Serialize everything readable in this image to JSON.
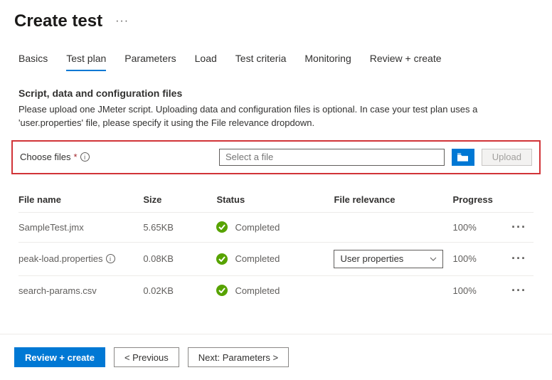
{
  "header": {
    "title": "Create test"
  },
  "tabs": [
    {
      "label": "Basics"
    },
    {
      "label": "Test plan"
    },
    {
      "label": "Parameters"
    },
    {
      "label": "Load"
    },
    {
      "label": "Test criteria"
    },
    {
      "label": "Monitoring"
    },
    {
      "label": "Review + create"
    }
  ],
  "section": {
    "title": "Script, data and configuration files",
    "desc": "Please upload one JMeter script. Uploading data and configuration files is optional. In case your test plan uses a 'user.properties' file, please specify it using the File relevance dropdown."
  },
  "choose": {
    "label": "Choose files",
    "required": "*",
    "placeholder": "Select a file",
    "upload": "Upload"
  },
  "table": {
    "headers": {
      "name": "File name",
      "size": "Size",
      "status": "Status",
      "relevance": "File relevance",
      "progress": "Progress"
    },
    "rows": [
      {
        "name": "SampleTest.jmx",
        "size": "5.65KB",
        "status": "Completed",
        "relevance": "",
        "progress": "100%"
      },
      {
        "name": "peak-load.properties",
        "size": "0.08KB",
        "status": "Completed",
        "relevance": "User properties",
        "progress": "100%"
      },
      {
        "name": "search-params.csv",
        "size": "0.02KB",
        "status": "Completed",
        "relevance": "",
        "progress": "100%"
      }
    ]
  },
  "footer": {
    "review": "Review + create",
    "prev": "< Previous",
    "next": "Next: Parameters >"
  }
}
